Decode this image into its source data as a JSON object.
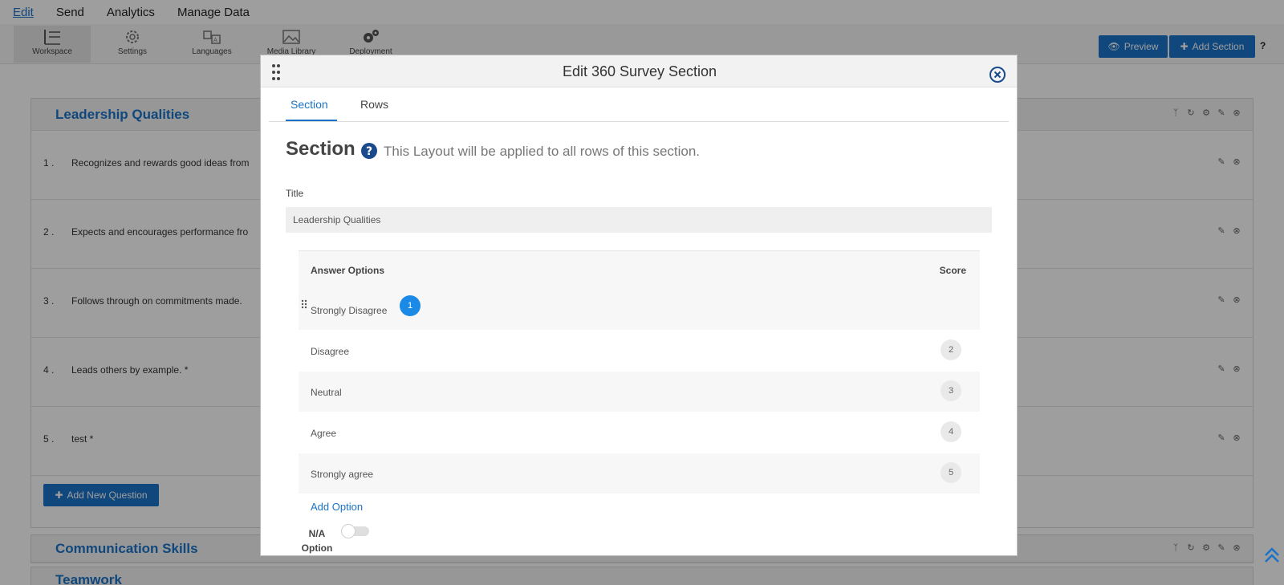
{
  "menu": [
    "Edit",
    "Send",
    "Analytics",
    "Manage Data"
  ],
  "toolbar": {
    "tools": [
      {
        "label": "Workspace",
        "icon": "workspace-icon"
      },
      {
        "label": "Settings",
        "icon": "gear-icon"
      },
      {
        "label": "Languages",
        "icon": "languages-icon"
      },
      {
        "label": "Media Library",
        "icon": "image-icon"
      },
      {
        "label": "Deployment",
        "icon": "gears-icon"
      }
    ],
    "preview_label": "Preview",
    "add_section_label": "Add Section",
    "help": "?"
  },
  "sections": [
    {
      "title": "Leadership Qualities",
      "questions": [
        {
          "num": "1 .",
          "text": "Recognizes and rewards good ideas from"
        },
        {
          "num": "2 .",
          "text": "Expects and encourages performance fro"
        },
        {
          "num": "3 .",
          "text": "Follows through on commitments made."
        },
        {
          "num": "4 .",
          "text": "Leads others by example. *"
        },
        {
          "num": "5 .",
          "text": "test *"
        }
      ],
      "add_question_label": "Add New Question"
    },
    {
      "title": "Communication Skills"
    },
    {
      "title": "Teamwork"
    }
  ],
  "modal": {
    "title": "Edit 360 Survey Section",
    "tabs": [
      "Section",
      "Rows"
    ],
    "heading": "Section",
    "description": "This Layout will be applied to all rows of this section.",
    "title_label": "Title",
    "title_value": "Leadership Qualities",
    "answers_header": "Answer Options",
    "score_header": "Score",
    "answers": [
      {
        "label": "Strongly Disagree",
        "score": "1"
      },
      {
        "label": "Disagree",
        "score": "2"
      },
      {
        "label": "Neutral",
        "score": "3"
      },
      {
        "label": "Agree",
        "score": "4"
      },
      {
        "label": "Strongly agree",
        "score": "5"
      }
    ],
    "add_option_label": "Add Option",
    "na_label_line1": "N/A",
    "na_label_line2": "Option",
    "na_enabled": false
  },
  "colors": {
    "accent": "#1a73c8",
    "score_active": "#1a8ae6",
    "overlay": "rgba(0,0,0,0.38)"
  }
}
